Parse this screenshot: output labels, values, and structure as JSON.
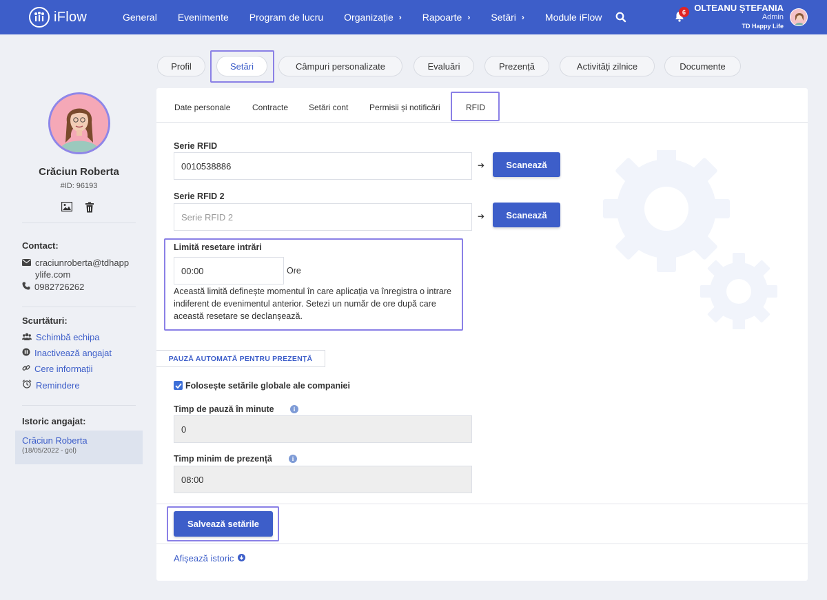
{
  "app": {
    "brand": "iFlow",
    "nav": [
      "General",
      "Evenimente",
      "Program de lucru",
      "Organizație",
      "Rapoarte",
      "Setări",
      "Module iFlow"
    ],
    "nav_chevrons": [
      false,
      false,
      false,
      true,
      true,
      true,
      false
    ],
    "notifications_count": "6",
    "user_name": "OLTEANU ȘTEFANIA",
    "user_role": "Admin",
    "company": "TD Happy Life"
  },
  "tabs": [
    "Profil",
    "Setări",
    "Câmpuri personalizate",
    "Evaluări",
    "Prezență",
    "Activități zilnice",
    "Documente"
  ],
  "active_tab": "Setări",
  "subtabs": [
    "Date personale",
    "Contracte",
    "Setări cont",
    "Permisii și notificări",
    "RFID"
  ],
  "active_subtab": "RFID",
  "employee": {
    "name": "Crăciun Roberta",
    "id": "#ID: 96193",
    "contact_title": "Contact:",
    "email": "craciunroberta@tdhappylife.com",
    "email_line1": "craciunroberta@tdhapp",
    "email_line2": "ylife.com",
    "phone": "0982726262",
    "shortcuts_title": "Scurtături:",
    "shortcuts": [
      "Schimbă echipa",
      "Inactivează angajat",
      "Cere informații",
      "Remindere"
    ],
    "history_title": "Istoric angajat:",
    "history_name": "Crăciun Roberta",
    "history_range": "(18/05/2022 - gol)"
  },
  "form": {
    "rfid1_label": "Serie RFID",
    "rfid1_value": "0010538886",
    "rfid2_label": "Serie RFID 2",
    "rfid2_placeholder": "Serie RFID 2",
    "scan_label": "Scanează",
    "reset_label": "Limită resetare intrări",
    "reset_value": "00:00",
    "reset_unit": "Ore",
    "reset_desc": "Această limită definește momentul în care aplicația va înregistra o intrare indiferent de evenimentul anterior. Setezi un număr de ore după care această resetare se declanșează.",
    "pause_section": "PAUZĂ AUTOMATĂ PENTRU PREZENȚĂ",
    "use_global_label": "Folosește setările globale ale companiei",
    "use_global_checked": true,
    "pause_minutes_label": "Timp de pauză în minute",
    "pause_minutes_value": "0",
    "min_presence_label": "Timp minim de prezență",
    "min_presence_value": "08:00",
    "save_label": "Salvează setările",
    "history_link": "Afișează istoric"
  },
  "colors": {
    "primary": "#3d5ec9",
    "highlight": "#8a80e6",
    "badge": "#e02424"
  }
}
